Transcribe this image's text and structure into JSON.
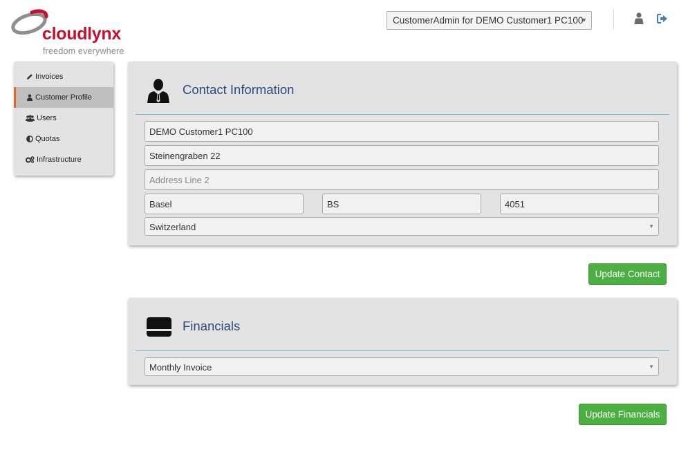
{
  "brand": {
    "name": "cloudlynx",
    "tagline": "freedom everywhere",
    "color": "#c8102e"
  },
  "header": {
    "account_select": "CustomerAdmin for DEMO Customer1 PC100",
    "icons": [
      "user-icon",
      "sign-out-icon"
    ]
  },
  "sidebar": {
    "items": [
      {
        "label": "Invoices",
        "icon": "pencil-icon",
        "active": false
      },
      {
        "label": "Customer Profile",
        "icon": "user-icon",
        "active": true
      },
      {
        "label": "Users",
        "icon": "users-icon",
        "active": false
      },
      {
        "label": "Quotas",
        "icon": "half-circle-icon",
        "active": false
      },
      {
        "label": "Infrastructure",
        "icon": "cogs-icon",
        "active": false
      }
    ],
    "active_color": "#e06a2c"
  },
  "contact": {
    "title": "Contact Information",
    "name": "DEMO Customer1 PC100",
    "address1": "Steinengraben 22",
    "address2_placeholder": "Address Line 2",
    "city": "Basel",
    "state": "BS",
    "zip": "4051",
    "country": "Switzerland",
    "button": "Update Contact"
  },
  "financials": {
    "title": "Financials",
    "billing": "Monthly Invoice",
    "button": "Update Financials"
  },
  "colors": {
    "button_green": "#4caf42",
    "title_blue": "#2d4a7a",
    "rule_blue": "#6fb3d6"
  }
}
